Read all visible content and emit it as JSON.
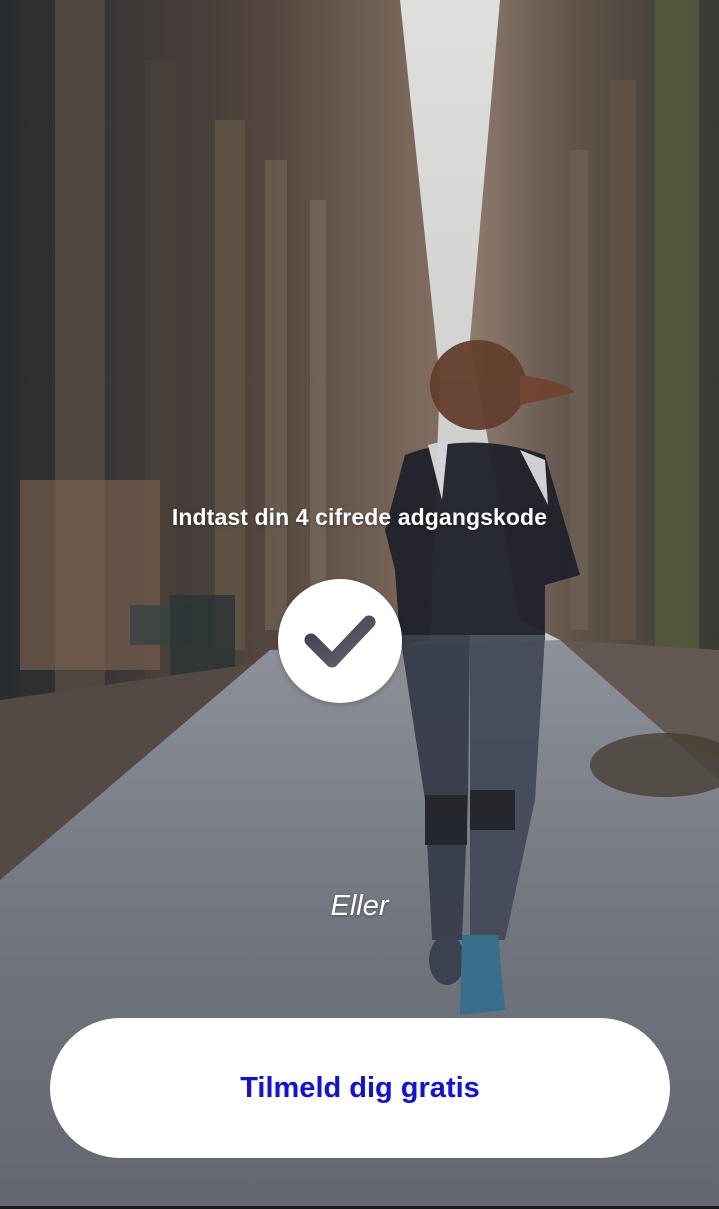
{
  "login": {
    "prompt": "Indtast din 4 cifrede adgangskode",
    "or_label": "Eller",
    "signup_label": "Tilmeld dig gratis"
  },
  "icons": {
    "confirm": "checkmark-icon"
  },
  "colors": {
    "signup_text": "#1010e0",
    "button_background": "#ffffff",
    "checkmark": "#4a4550"
  }
}
